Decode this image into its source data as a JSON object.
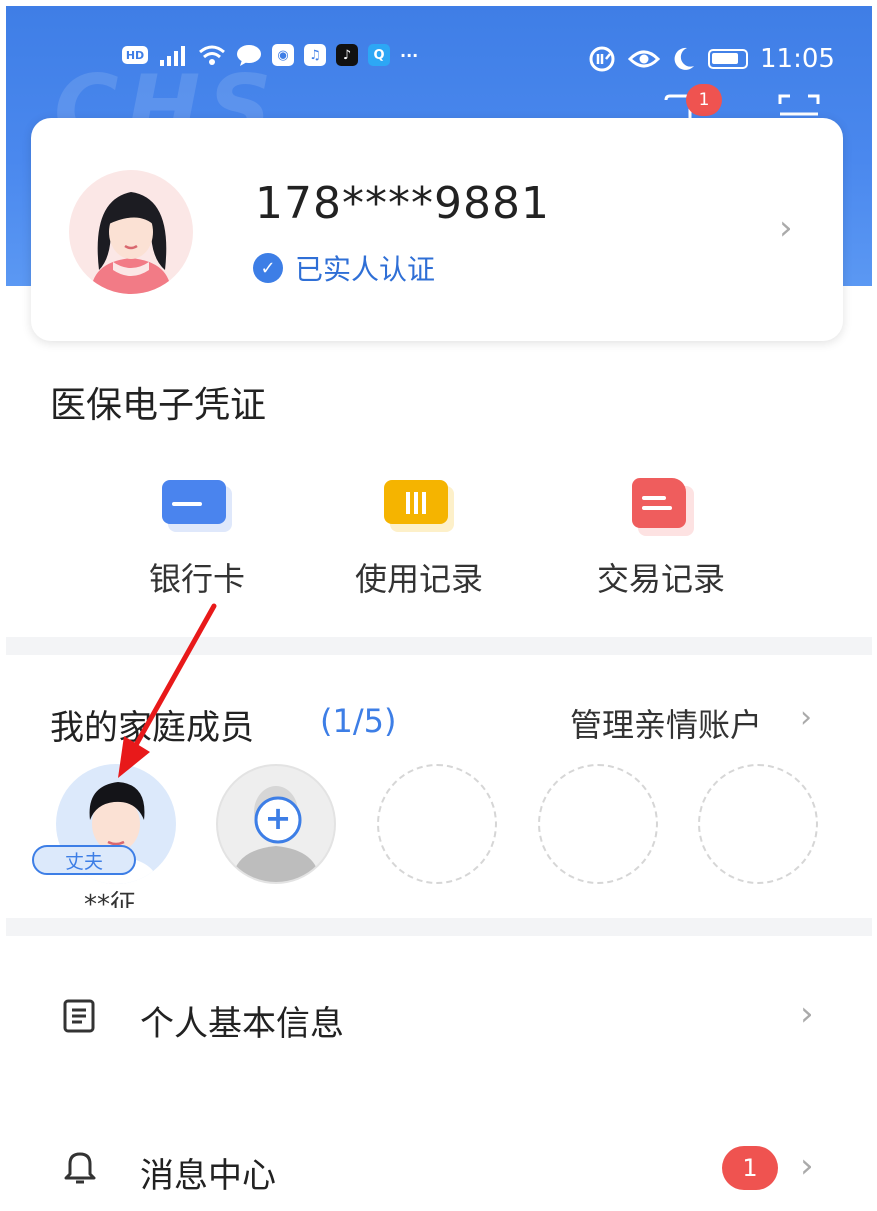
{
  "status_bar": {
    "left_icons": [
      "hd-icon",
      "signal-4g-icon",
      "wifi-icon",
      "chat-bubble-icon",
      "bulb-app-icon",
      "music-app-icon",
      "tiktok-app-icon",
      "search-app-icon",
      "more-dots-icon"
    ],
    "hd_label": "HD",
    "more_dots": "···",
    "right_icons": [
      "data-usage-icon",
      "eye-icon",
      "moon-icon",
      "battery-icon"
    ],
    "time": "11:05"
  },
  "header": {
    "message_badge": "1",
    "message_icon": "message-icon",
    "scan_icon": "scan-icon",
    "watermark": "CHS"
  },
  "profile": {
    "phone": "178****9881",
    "verified_label": "已实人认证",
    "verified_icon": "check-circle-icon",
    "chevron": "›"
  },
  "voucher": {
    "title": "医保电子凭证",
    "items": [
      {
        "label": "银行卡",
        "icon": "bank-card-icon",
        "color": "#4a84ee"
      },
      {
        "label": "使用记录",
        "icon": "usage-record-icon",
        "color": "#f5b400"
      },
      {
        "label": "交易记录",
        "icon": "transaction-record-icon",
        "color": "#ef5d5d"
      }
    ]
  },
  "family": {
    "title": "我的家庭成员",
    "count": "(1/5)",
    "manage_label": "管理亲情账户",
    "chevron": "›",
    "members": [
      {
        "tag": "丈夫",
        "name": "**征"
      }
    ],
    "add_symbol": "+"
  },
  "menu": [
    {
      "label": "个人基本信息",
      "icon": "document-icon",
      "chevron": "›"
    },
    {
      "label": "消息中心",
      "icon": "bell-icon",
      "badge": "1",
      "chevron": "›"
    }
  ],
  "colors": {
    "header_blue": "#4a88ee",
    "accent": "#3d7ee6",
    "badge_red": "#ef5350",
    "annotation_arrow": "#e8191a"
  }
}
